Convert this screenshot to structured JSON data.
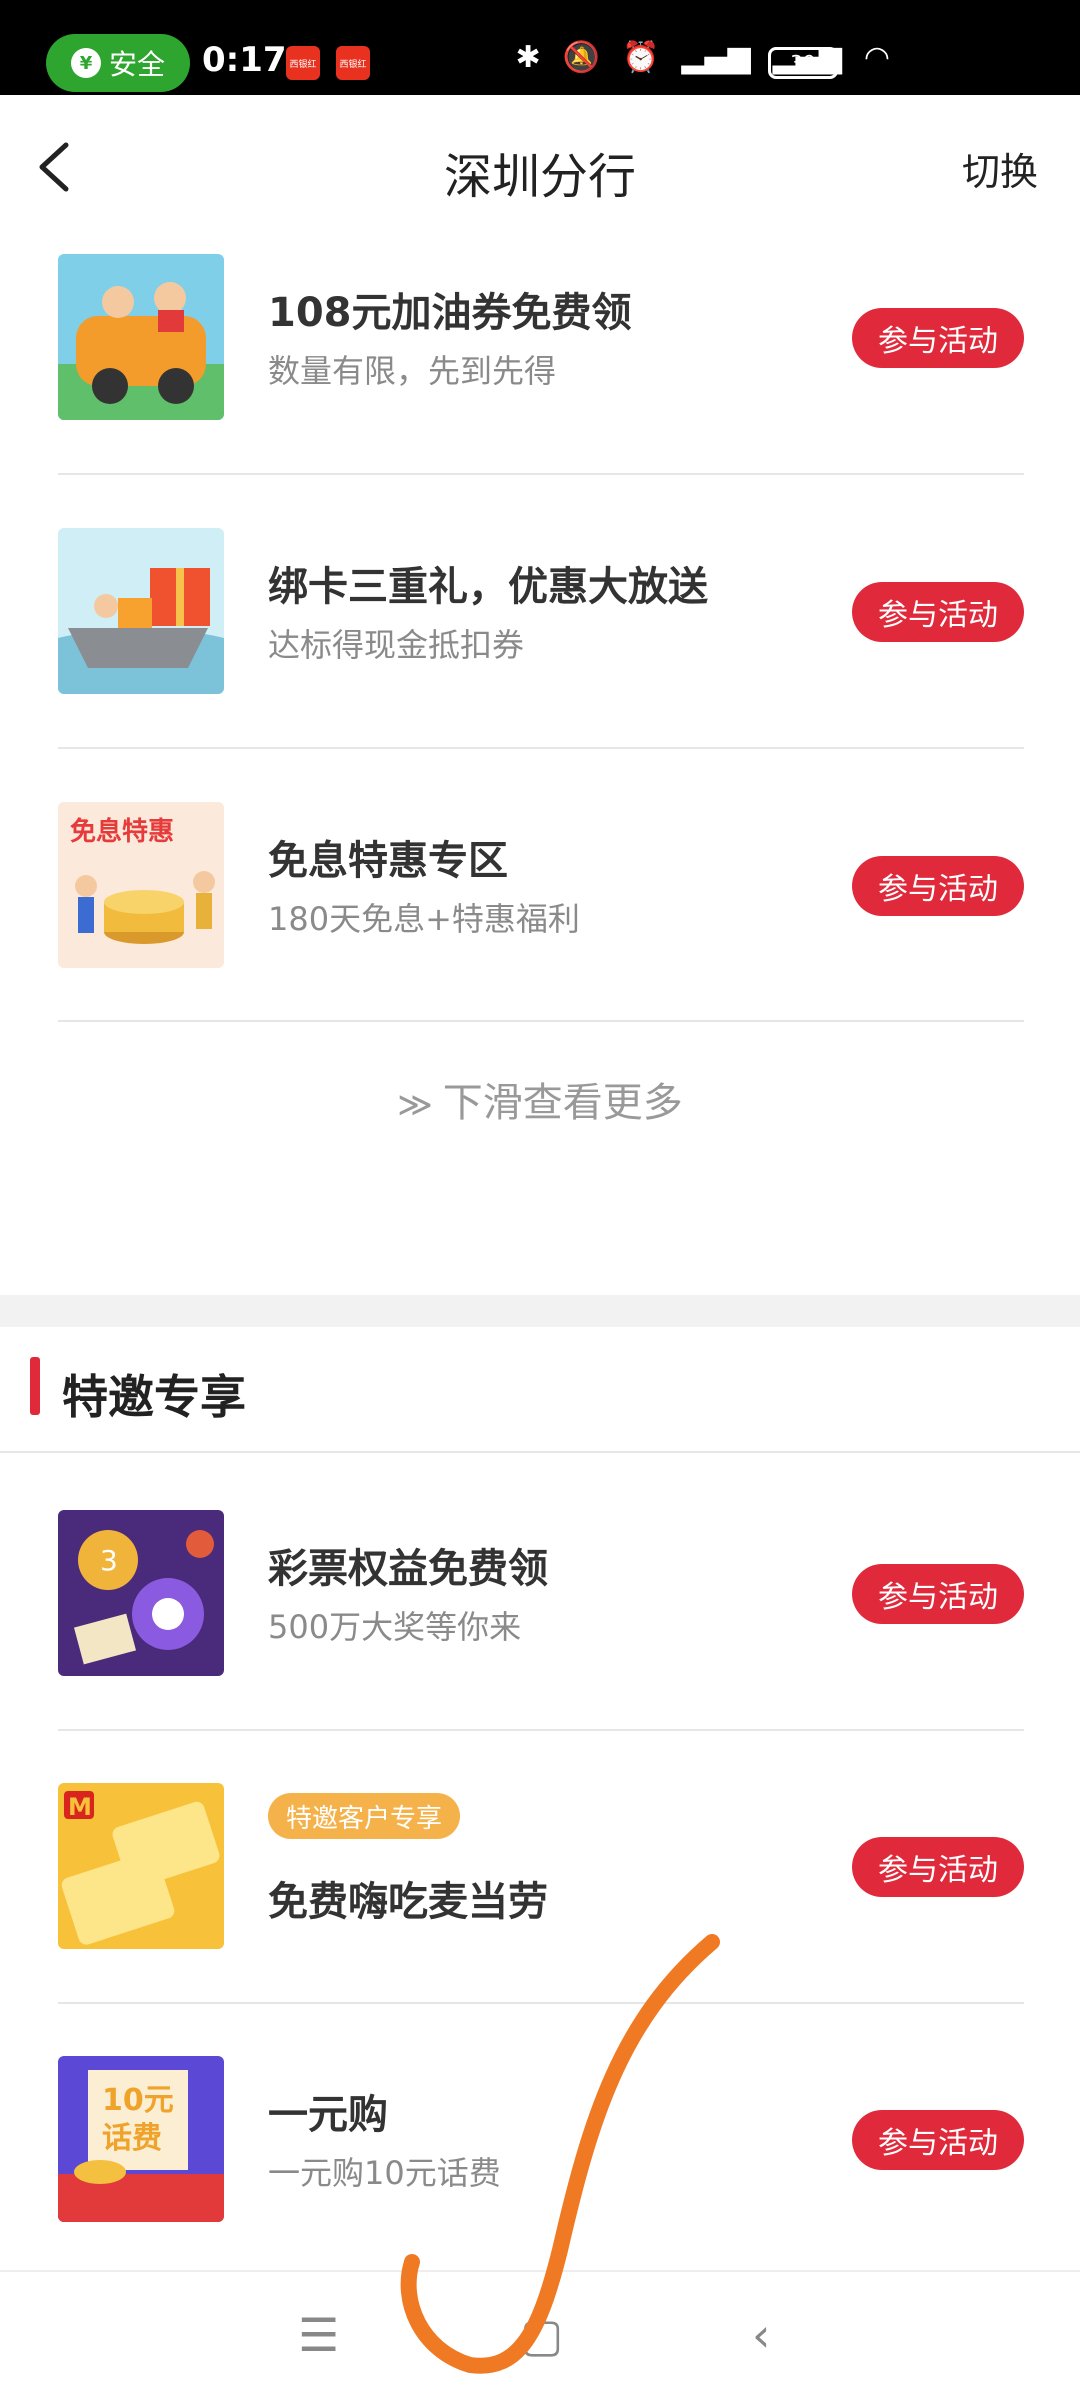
{
  "status_bar": {
    "safe_label": "安全",
    "time": "0:17",
    "notif_label": "西银红",
    "battery": "39"
  },
  "header": {
    "title": "深圳分行",
    "switch_label": "切换"
  },
  "activities": [
    {
      "title": "108元加油券免费领",
      "subtitle": "数量有限，先到先得",
      "button": "参与活动"
    },
    {
      "title": "绑卡三重礼，优惠大放送",
      "subtitle": "达标得现金抵扣券",
      "button": "参与活动"
    },
    {
      "title": "免息特惠专区",
      "subtitle": "180天免息+特惠福利",
      "button": "参与活动",
      "thumb_text": "免息特惠"
    }
  ],
  "more_label": "下滑查看更多",
  "special_section": {
    "title": "特邀专享",
    "items": [
      {
        "title": "彩票权益免费领",
        "subtitle": "500万大奖等你来",
        "button": "参与活动"
      },
      {
        "tag": "特邀客户专享",
        "title": "免费嗨吃麦当劳",
        "button": "参与活动"
      },
      {
        "title": "一元购",
        "subtitle": "一元购10元话费",
        "button": "参与活动",
        "thumb_text_1": "10元",
        "thumb_text_2": "话费"
      }
    ]
  },
  "nav": {
    "icons": [
      "menu-icon",
      "home-icon",
      "back-icon"
    ]
  },
  "colors": {
    "accent": "#e02a3b",
    "safe_green": "#2ea52e",
    "tag_orange": "#f6b24a"
  }
}
